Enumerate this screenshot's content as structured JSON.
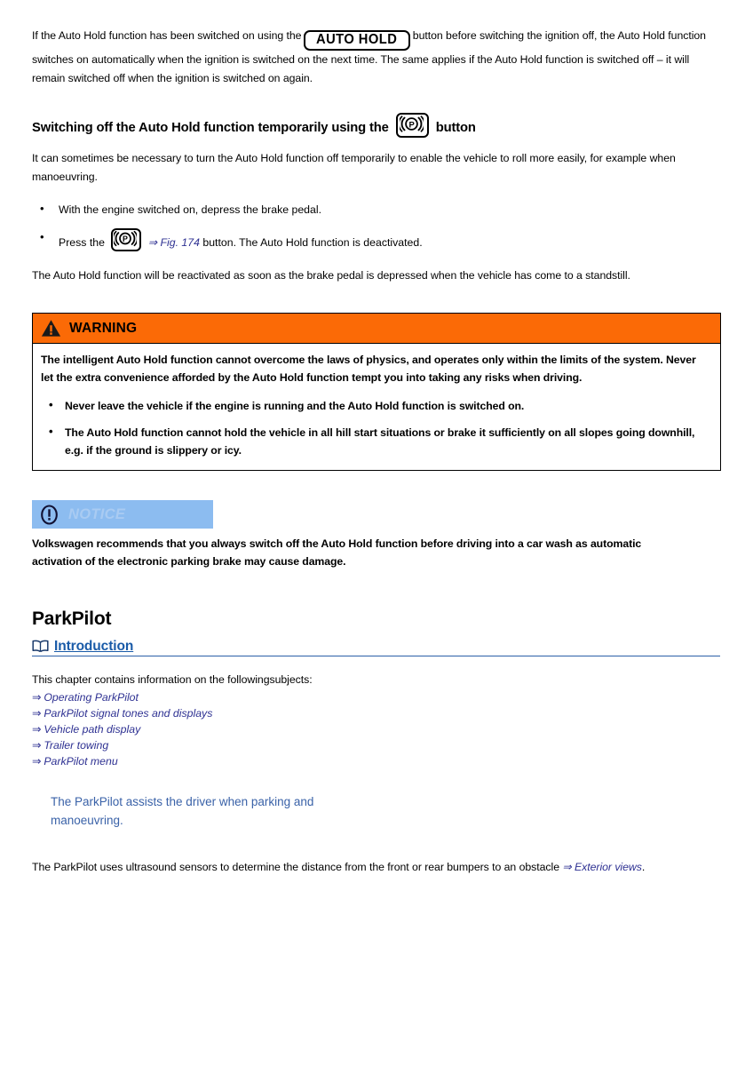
{
  "intro": {
    "text_before_button": "If the Auto Hold function has been switched on using the",
    "button_label": "AUTO HOLD",
    "text_after_button": "button before switching the ignition off, the Auto Hold function switches on automatically when the ignition is switched on the next time. The same applies if the Auto Hold function is switched off – it will remain switched off when the ignition is switched on again."
  },
  "section": {
    "heading_before_icon": "Switching off the Auto Hold function temporarily using the",
    "heading_icon": "parking-brake-icon",
    "heading_after_icon": "button",
    "paragraph": "It can sometimes be necessary to turn the Auto Hold function off temporarily to enable the vehicle to roll more easily, for example when manoeuvring.",
    "steps": [
      {
        "text": "With the engine switched on, depress the brake pedal."
      }
    ],
    "step_press": {
      "before": "Press the",
      "xref": "⇒ Fig. 174",
      "after": "button. The Auto Hold function is deactivated."
    },
    "closing_paragraph": "The Auto Hold function will be reactivated as soon as the brake pedal is depressed when the vehicle has come to a standstill."
  },
  "warning": {
    "title": "WARNING",
    "icon": "warning-triangle-icon",
    "header_bg": "#fb6a06",
    "body": "The intelligent Auto Hold function cannot overcome the laws of physics, and operates only within the limits of the system. Never let the extra convenience afforded by the Auto Hold function tempt you into taking any risks when driving.",
    "bullets": [
      "Never leave the vehicle if the engine is running and the Auto Hold function is switched on.",
      "The Auto Hold function cannot hold the vehicle in all hill start situations or brake it sufficiently on all slopes going downhill, e.g. if the ground is slippery or icy."
    ]
  },
  "notice": {
    "title": "NOTICE",
    "icon": "exclamation-circle-icon",
    "header_bg": "#8cbcf0",
    "body": "Volkswagen recommends that you always switch off the Auto Hold function before driving into a car wash as automatic activation of the electronic parking brake may cause damage."
  },
  "chapter": {
    "title": "ParkPilot",
    "subheading": "Introduction",
    "subheading_icon": "open-book-icon",
    "subheading_color": "#1a5ba8",
    "intro_line": "This chapter contains information on the followingsubjects:",
    "links": [
      {
        "arrow": "⇒",
        "label": "Operating ParkPilot"
      },
      {
        "arrow": "⇒",
        "label": "ParkPilot signal tones and displays"
      },
      {
        "arrow": "⇒",
        "label": "Vehicle path display"
      },
      {
        "arrow": "⇒",
        "label": "Trailer towing"
      },
      {
        "arrow": "⇒",
        "label": "ParkPilot menu"
      }
    ],
    "blue_block": "The ParkPilot assists the driver when parking and manoeuvring.",
    "closing": {
      "before": "The ParkPilot uses ultrasound sensors to determine the distance from the front or rear bumpers to an obstacle",
      "xref": "⇒ Exterior views",
      "after": "."
    }
  }
}
